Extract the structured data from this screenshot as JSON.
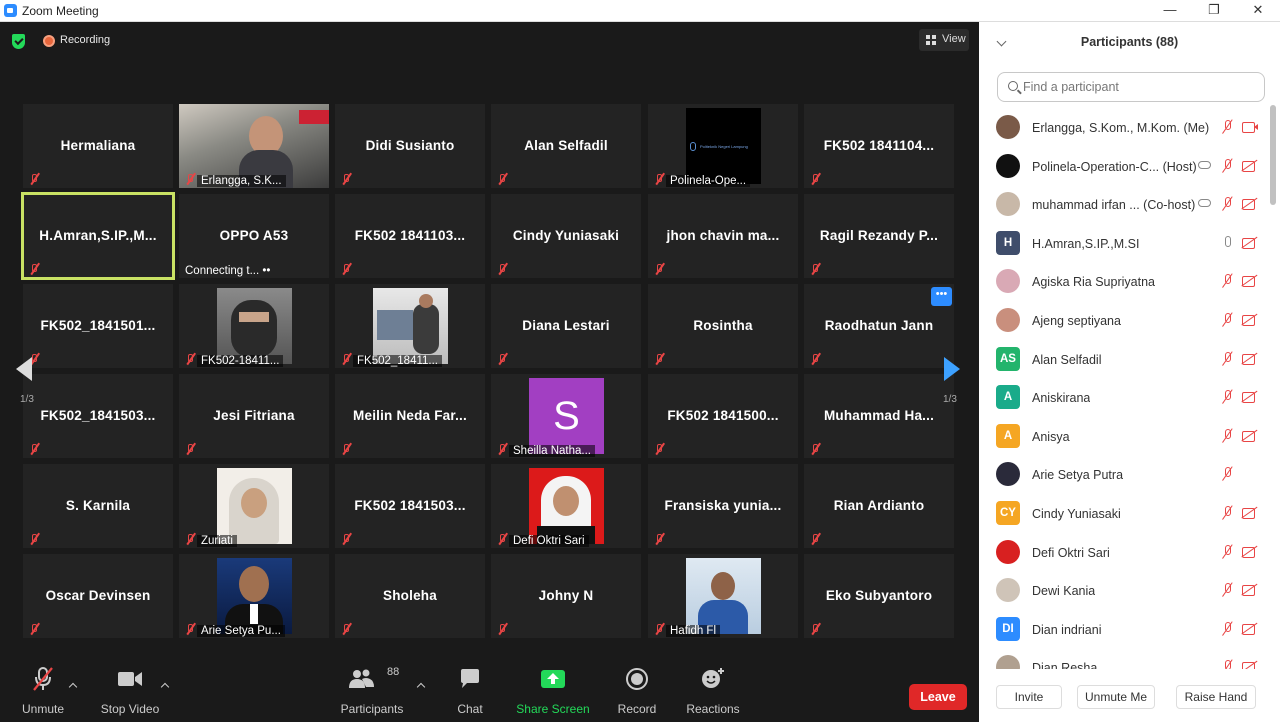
{
  "window": {
    "title": "Zoom Meeting",
    "minimize": "—",
    "maximize": "❐",
    "close": "✕"
  },
  "topbar": {
    "recording_label": "Recording",
    "view_label": "View"
  },
  "tiles": [
    {
      "name": "Hermaliana",
      "video": false
    },
    {
      "name": "",
      "caption": "Erlangga, S.K...",
      "video": true,
      "video_kind": "webcam"
    },
    {
      "name": "Didi Susianto",
      "video": false
    },
    {
      "name": "Alan Selfadil",
      "video": false
    },
    {
      "name": "",
      "caption": "Polinela-Ope...",
      "video": true,
      "video_kind": "logo"
    },
    {
      "name": "FK502 1841104...",
      "video": false
    },
    {
      "name": "H.Amran,S.IP.,M...",
      "video": false,
      "active": true
    },
    {
      "name": "OPPO A53",
      "caption": "Connecting t...  ••",
      "video": false,
      "connecting": true
    },
    {
      "name": "FK502 1841103...",
      "video": false
    },
    {
      "name": "Cindy Yuniasaki",
      "video": false
    },
    {
      "name": "jhon chavin ma...",
      "video": false
    },
    {
      "name": "Ragil Rezandy P...",
      "video": false
    },
    {
      "name": "FK502_1841501...",
      "video": false
    },
    {
      "name": "",
      "caption": "FK502-18411...",
      "video": true,
      "video_kind": "masked"
    },
    {
      "name": "",
      "caption": "FK502_18411...",
      "video": true,
      "video_kind": "office"
    },
    {
      "name": "Diana Lestari",
      "video": false
    },
    {
      "name": "Rosintha",
      "video": false
    },
    {
      "name": "Raodhatun Jann",
      "video": false
    },
    {
      "name": "FK502_1841503...",
      "video": false
    },
    {
      "name": "Jesi Fitriana",
      "video": false
    },
    {
      "name": "Meilin Neda Far...",
      "video": false
    },
    {
      "name": "",
      "caption": "Sheilla Natha...",
      "video": true,
      "video_kind": "letter",
      "letter": "S"
    },
    {
      "name": "FK502 1841500...",
      "video": false
    },
    {
      "name": "Muhammad Ha...",
      "video": false
    },
    {
      "name": "S. Karnila",
      "video": false
    },
    {
      "name": "",
      "caption": "Zuriati",
      "video": true,
      "video_kind": "hijab_light"
    },
    {
      "name": "FK502 1841503...",
      "video": false
    },
    {
      "name": "",
      "caption": "Defi Oktri Sari",
      "video": true,
      "video_kind": "hijab_red"
    },
    {
      "name": "Fransiska yunia...",
      "video": false
    },
    {
      "name": "Rian Ardianto",
      "video": false
    },
    {
      "name": "Oscar Devinsen",
      "video": false
    },
    {
      "name": "",
      "caption": "Arie Setya Pu...",
      "video": true,
      "video_kind": "suit"
    },
    {
      "name": "Sholeha",
      "video": false
    },
    {
      "name": "Johny N",
      "video": false
    },
    {
      "name": "",
      "caption": "Hafidh Fl",
      "video": true,
      "video_kind": "man_blue"
    },
    {
      "name": "Eko Subyantoro",
      "video": false
    }
  ],
  "pager": {
    "left": "1/3",
    "right": "1/3",
    "more": "•••"
  },
  "toolbar": {
    "unmute": "Unmute",
    "stop_video": "Stop Video",
    "participants": "Participants",
    "participants_count": "88",
    "chat": "Chat",
    "share_screen": "Share Screen",
    "record": "Record",
    "reactions": "Reactions",
    "leave": "Leave"
  },
  "panel": {
    "title": "Participants (88)",
    "search_placeholder": "Find a participant",
    "participants": [
      {
        "name": "Erlangga, S.Kom., M.Kom. (Me)",
        "avatar": "photo",
        "mic": "off",
        "cam": "on",
        "avatar_color": "#7a5a48"
      },
      {
        "name": "Polinela-Operation-C... (Host)",
        "avatar": "photo",
        "mic": "off",
        "cam": "off",
        "cloud": true,
        "avatar_color": "#111111"
      },
      {
        "name": "muhammad irfan ... (Co-host)",
        "avatar": "photo",
        "mic": "off",
        "cam": "off",
        "cloud": true,
        "avatar_color": "#c8b8a8"
      },
      {
        "name": "H.Amran,S.IP.,M.SI",
        "avatar": "H",
        "mic": "on",
        "cam": "off",
        "avatar_color": "#3f4d6b"
      },
      {
        "name": "Agiska Ria Supriyatna",
        "avatar": "photo",
        "mic": "off",
        "cam": "off",
        "avatar_color": "#d9a9b5"
      },
      {
        "name": "Ajeng septiyana",
        "avatar": "photo",
        "mic": "off",
        "cam": "off",
        "avatar_color": "#c98f7d"
      },
      {
        "name": "Alan Selfadil",
        "avatar": "AS",
        "mic": "off",
        "cam": "off",
        "avatar_color": "#23b46c"
      },
      {
        "name": "Aniskirana",
        "avatar": "A",
        "mic": "off",
        "cam": "off",
        "avatar_color": "#1aab8a"
      },
      {
        "name": "Anisya",
        "avatar": "A",
        "mic": "off",
        "cam": "off",
        "avatar_color": "#f5a623"
      },
      {
        "name": "Arie Setya Putra",
        "avatar": "photo",
        "mic": "off",
        "cam": "none",
        "avatar_color": "#2a2a3a"
      },
      {
        "name": "Cindy Yuniasaki",
        "avatar": "CY",
        "mic": "off",
        "cam": "off",
        "avatar_color": "#f5a623"
      },
      {
        "name": "Defi Oktri Sari",
        "avatar": "photo",
        "mic": "off",
        "cam": "off",
        "avatar_color": "#d82020"
      },
      {
        "name": "Dewi Kania",
        "avatar": "photo",
        "mic": "off",
        "cam": "off",
        "avatar_color": "#cfc4b8"
      },
      {
        "name": "Dian indriani",
        "avatar": "DI",
        "mic": "off",
        "cam": "off",
        "avatar_color": "#2d8cff"
      },
      {
        "name": "Dian Resha",
        "avatar": "photo",
        "mic": "off",
        "cam": "off",
        "avatar_color": "#b0a090"
      }
    ],
    "buttons": {
      "invite": "Invite",
      "unmute_me": "Unmute Me",
      "raise_hand": "Raise Hand"
    }
  }
}
